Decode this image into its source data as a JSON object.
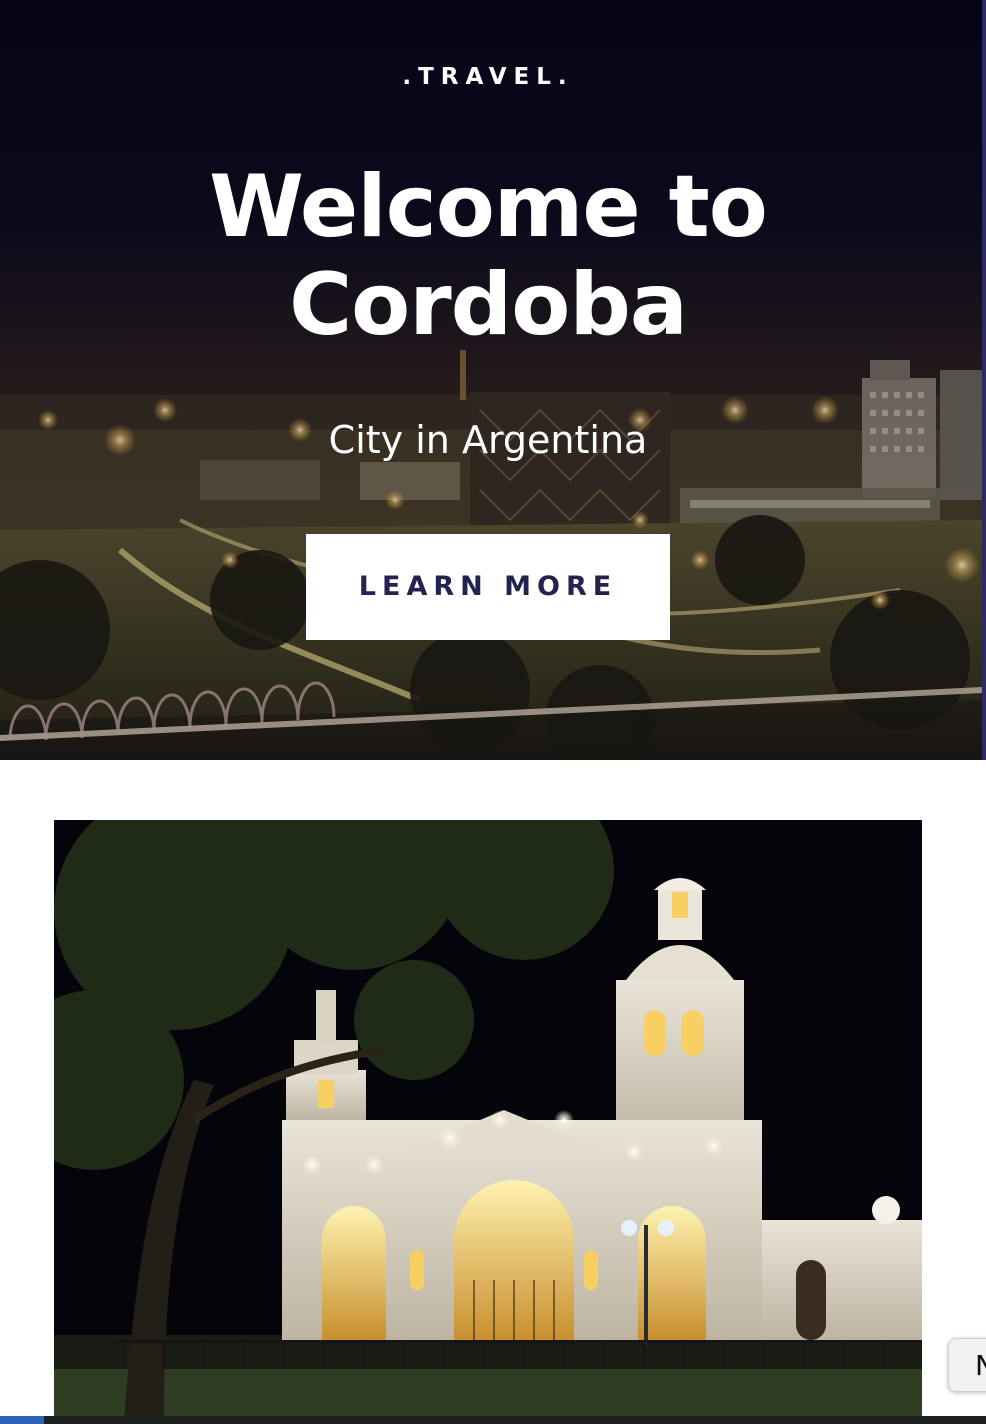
{
  "hero": {
    "brand": ".TRAVEL.",
    "title_line1": "Welcome to",
    "title_line2": "Cordoba",
    "subtitle": "City in Argentina",
    "cta_label": "LEARN MORE",
    "background": "night-city-skyline"
  },
  "gallery": {
    "photo": "cathedral-at-night"
  },
  "widget": {
    "label": "N"
  },
  "colors": {
    "button_text": "#24224f",
    "hero_top": "#070618",
    "edge": "#2d2a63",
    "bottom_blue": "#2c63b8"
  }
}
